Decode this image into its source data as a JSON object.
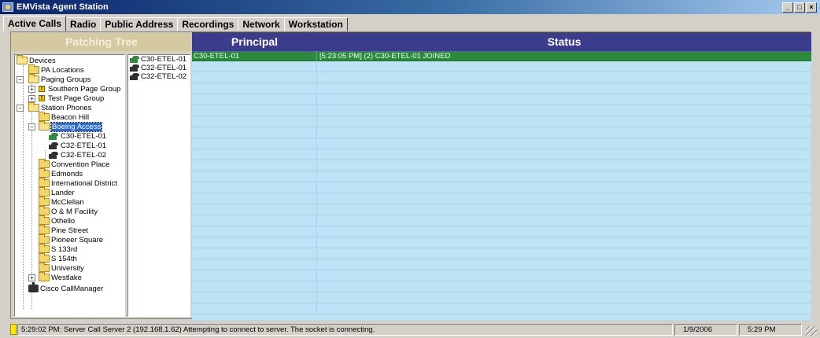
{
  "window": {
    "title": "EMVista Agent Station",
    "min": "_",
    "max": "□",
    "close": "×"
  },
  "tabs": [
    {
      "label": "Active Calls",
      "active": true
    },
    {
      "label": "Radio"
    },
    {
      "label": "Public Address"
    },
    {
      "label": "Recordings"
    },
    {
      "label": "Network"
    },
    {
      "label": "Workstation"
    }
  ],
  "headers": {
    "patching_tree": "Patching Tree",
    "principal": "Principal",
    "status": "Status"
  },
  "tree": {
    "root": "Devices",
    "pa_locations": "PA Locations",
    "paging_groups": "Paging Groups",
    "southern_page_group": "Southern Page Group",
    "test_page_group": "Test Page Group",
    "station_phones": "Station Phones",
    "beacon_hill": "Beacon Hill",
    "boeing_access": "Boeing Access",
    "phone_c30_etel_01": "C30-ETEL-01",
    "phone_c32_etel_01": "C32-ETEL-01",
    "phone_c32_etel_02": "C32-ETEL-02",
    "stations": [
      "Convention Place",
      "Edmonds",
      "International District",
      "Lander",
      "McClellan",
      "O & M Facility",
      "Othello",
      "Pine Street",
      "Pioneer Square",
      "S 133rd",
      "S 154th",
      "University",
      "Westlake"
    ],
    "cisco": "Cisco CallManager"
  },
  "patch_list": [
    "C30-ETEL-01",
    "C32-ETEL-01",
    "C32-ETEL-02"
  ],
  "calls": [
    {
      "principal": "C30-ETEL-01",
      "status": "[5:23:05 PM] (2) C30-ETEL-01 JOINED"
    }
  ],
  "statusbar": {
    "message": "5:29:02 PM: Server Call Server 2 (192.168.1.62) Attempting to connect to server. The socket is connecting.",
    "date": "1/9/2006",
    "time": "5:29 PM"
  },
  "colors": {
    "header_blue": "#3c3c8c",
    "patching_header": "#d5c9a1",
    "grid_bg": "#bfe3f6",
    "call_row_green": "#2b8a3e"
  }
}
